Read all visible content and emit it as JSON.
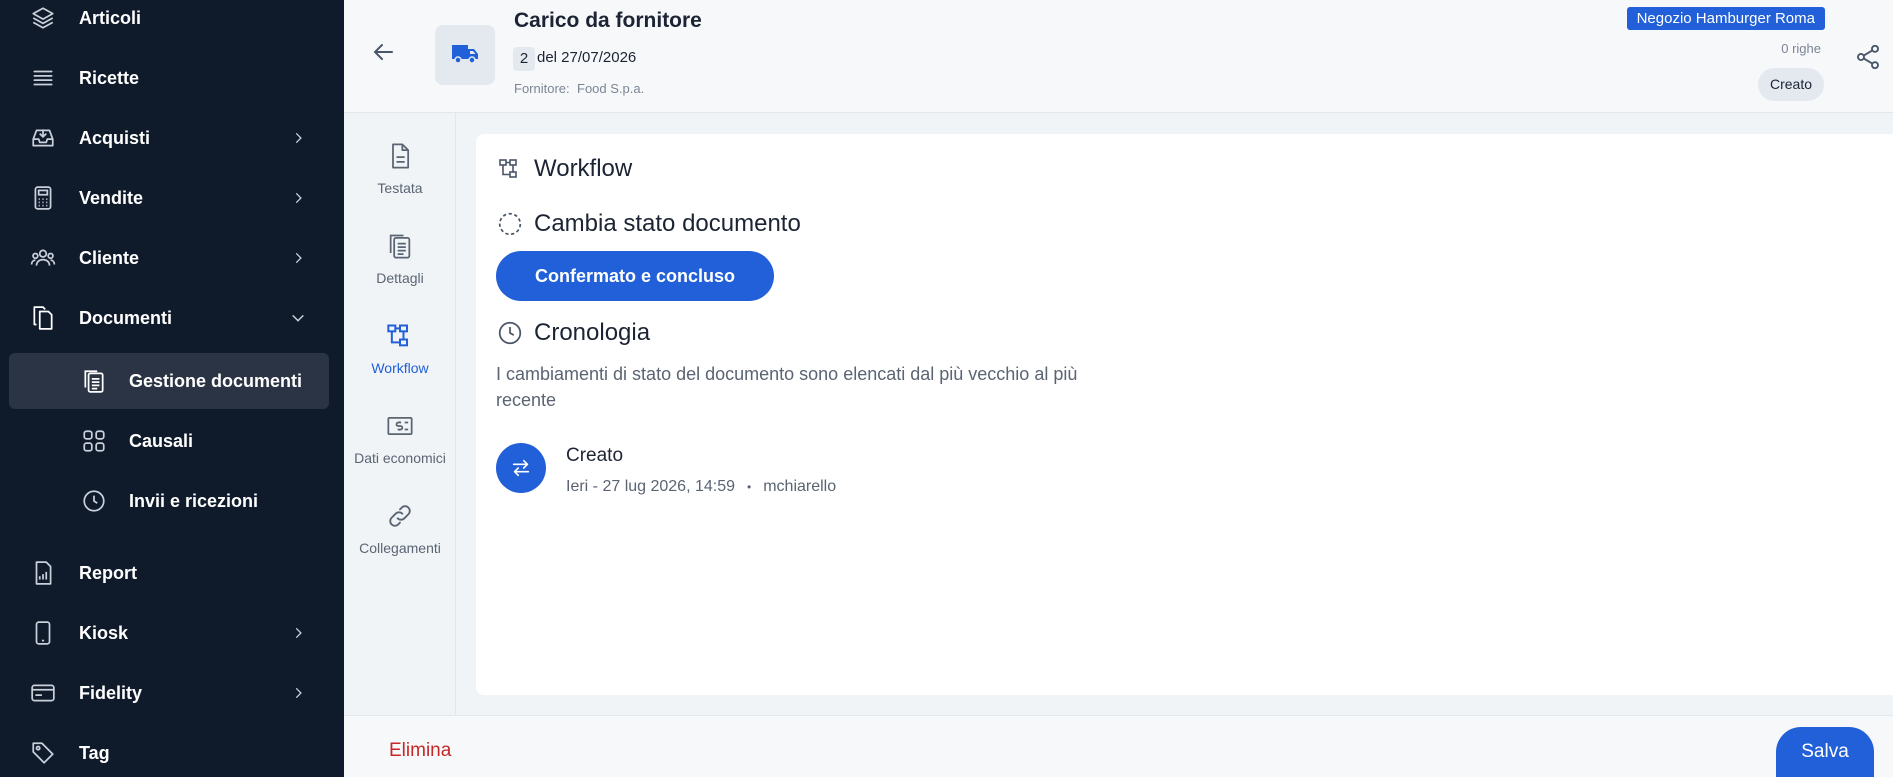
{
  "sidebar": {
    "items": [
      {
        "label": "Articoli",
        "icon": "layers-icon"
      },
      {
        "label": "Ricette",
        "icon": "list-icon"
      },
      {
        "label": "Acquisti",
        "icon": "inbox-tray-icon"
      },
      {
        "label": "Vendite",
        "icon": "calculator-icon"
      },
      {
        "label": "Cliente",
        "icon": "users-icon"
      },
      {
        "label": "Documenti",
        "icon": "documents-icon",
        "expanded": true
      },
      {
        "label": "Report",
        "icon": "report-chart-icon"
      },
      {
        "label": "Kiosk",
        "icon": "tablet-icon"
      },
      {
        "label": "Fidelity",
        "icon": "card-icon"
      },
      {
        "label": "Tag",
        "icon": "tag-icon"
      }
    ],
    "sub_items": [
      {
        "label": "Gestione documenti",
        "icon": "clipboard-icon",
        "active": true
      },
      {
        "label": "Causali",
        "icon": "grid-icon"
      },
      {
        "label": "Invii e ricezioni",
        "icon": "clock-icon"
      }
    ]
  },
  "header": {
    "title": "Carico da fornitore",
    "number": "2",
    "date": "del 27/07/2026",
    "supplier_label": "Fornitore:",
    "supplier_value": "Food S.p.a.",
    "store": "Negozio Hamburger Roma",
    "rows": "0 righe",
    "status": "Creato"
  },
  "tabs": [
    {
      "label": "Testata",
      "icon": "file-text-icon"
    },
    {
      "label": "Dettagli",
      "icon": "clipboard-list-icon"
    },
    {
      "label": "Workflow",
      "icon": "workflow-icon",
      "active": true
    },
    {
      "label": "Dati economici",
      "icon": "money-icon"
    },
    {
      "label": "Collegamenti",
      "icon": "link-icon"
    }
  ],
  "main": {
    "workflow_title": "Workflow",
    "change_state_title": "Cambia stato documento",
    "confirm_button": "Confermato e concluso",
    "history_title": "Cronologia",
    "history_desc": "I cambiamenti di stato del documento sono elencati dal più vecchio al più recente",
    "event": {
      "title": "Creato",
      "when": "Ieri - 27 lug 2026, 14:59",
      "dot": "•",
      "user": "mchiarello"
    }
  },
  "footer": {
    "delete_label": "Elimina",
    "save_label": "Salva"
  },
  "colors": {
    "sidebar_bg": "#0f1a2b",
    "accent": "#2160d8",
    "danger": "#c62828"
  }
}
